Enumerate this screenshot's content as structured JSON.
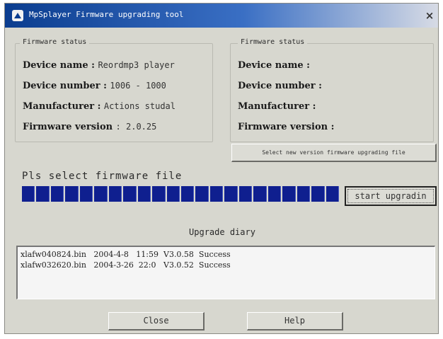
{
  "window": {
    "title": "MpSplayer Firmware upgrading tool",
    "close_label": "×"
  },
  "left_status": {
    "legend": "Firmware status",
    "device_name_label": "Device name :",
    "device_name_value": "Reordmp3 player",
    "device_number_label": "Device number :",
    "device_number_value": "1006 - 1000",
    "manufacturer_label": "Manufacturer :",
    "manufacturer_value": "Actions studal",
    "firmware_version_label": "Firmware version",
    "firmware_version_value": ": 2.0.25"
  },
  "right_status": {
    "legend": "Firmware status",
    "device_name_label": "Device name :",
    "device_number_label": "Device number :",
    "manufacturer_label": "Manufacturer :",
    "firmware_version_label": "Firmware version :"
  },
  "select_button_label": "Select new version firmware upgrading file",
  "prompt_text": "Pls select firmware file",
  "progress": {
    "segments": 22,
    "fill_fraction": 1.0,
    "color": "#0f1f8f"
  },
  "start_button_label": "start upgradin",
  "diary": {
    "title": "Upgrade diary",
    "lines": [
      "xlafw040824.bin   2004-4-8   11:59  V3.0.58  Success",
      "xlafw032620.bin   2004-3-26  22:0   V3.0.52  Success"
    ]
  },
  "close_button_label": "Close",
  "help_button_label": "Help"
}
